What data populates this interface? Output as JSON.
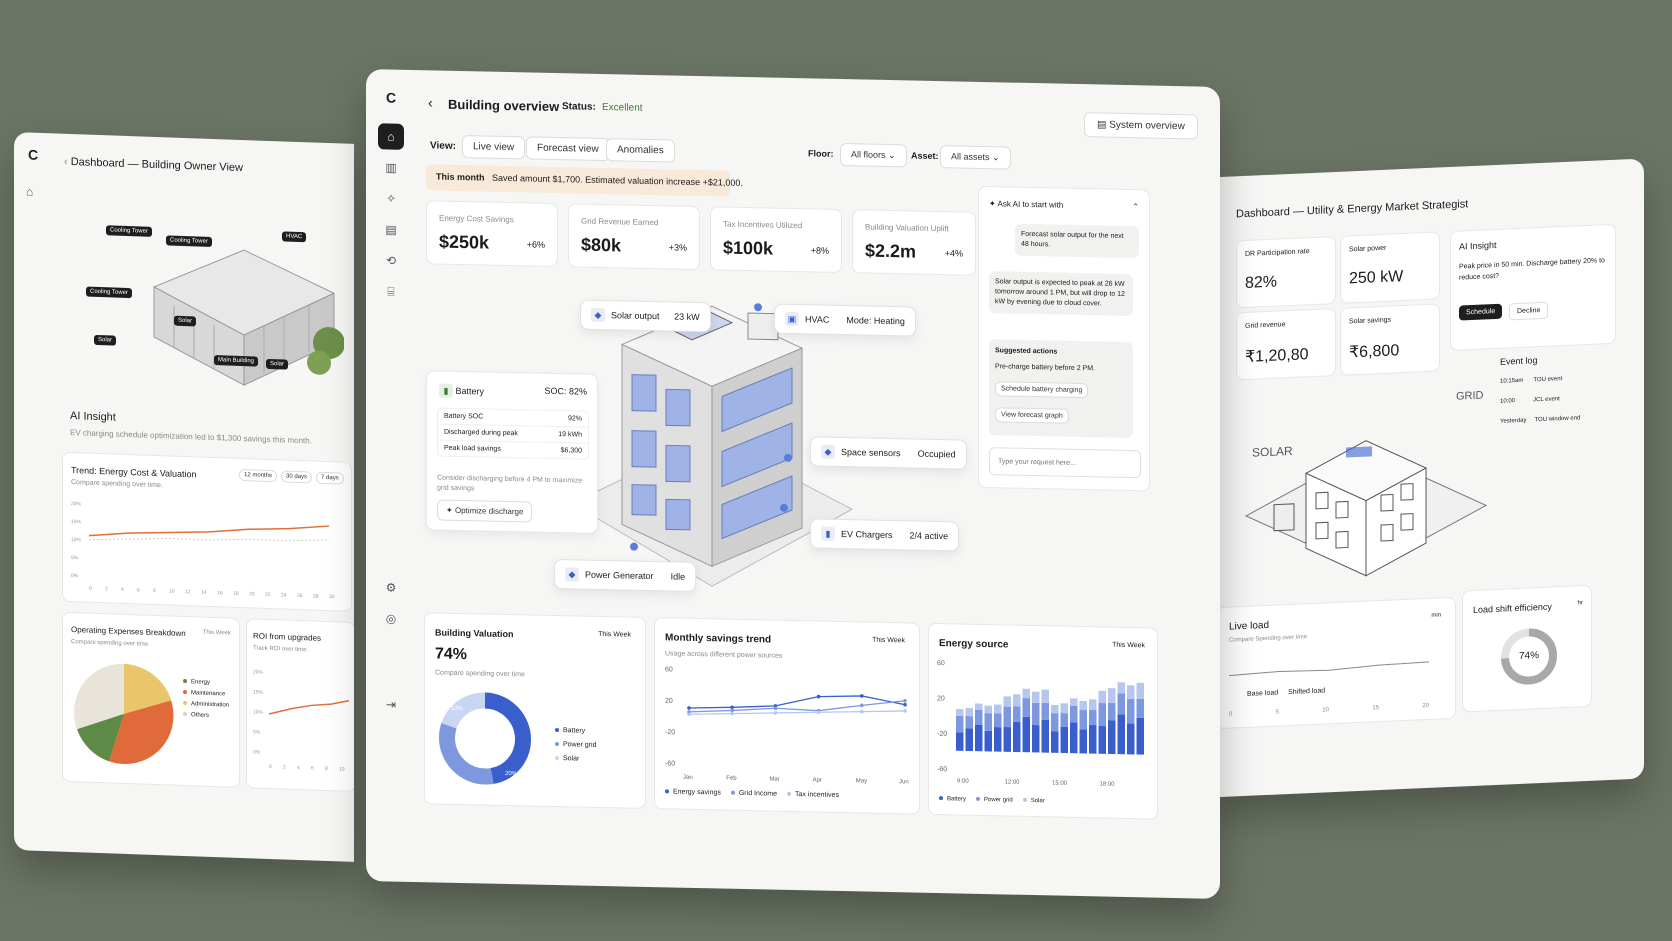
{
  "left": {
    "logo": "C",
    "title": "Dashboard — Building Owner View",
    "tags": [
      "Cooling Tower",
      "Cooling Tower",
      "HVAC",
      "Cooling Tower",
      "Solar",
      "Solar",
      "Main Building",
      "Solar"
    ],
    "ai_insight": {
      "title": "AI Insight",
      "text": "EV charging schedule optimization led to $1,300 savings this month."
    },
    "trend": {
      "title": "Trend: Energy Cost & Valuation",
      "subtitle": "Compare spending over time.",
      "ranges": [
        "12 months",
        "30 days",
        "7 days"
      ],
      "yticks": [
        "20%",
        "15%",
        "10%",
        "5%",
        "0%"
      ],
      "xticks": [
        "0",
        "2",
        "4",
        "6",
        "8",
        "10",
        "12",
        "14",
        "16",
        "18",
        "20",
        "22",
        "24",
        "26",
        "28",
        "30"
      ]
    },
    "opex": {
      "title": "Operating Expenses Breakdown",
      "subtitle": "Compare spending over time.",
      "period": "This Week",
      "legend": [
        "Energy",
        "Maintenance",
        "Administration",
        "Others"
      ]
    },
    "roi": {
      "title": "ROI from upgrades",
      "subtitle": "Track ROI over time.",
      "yticks": [
        "20%",
        "15%",
        "10%",
        "5%",
        "0%"
      ],
      "xticks": [
        "0",
        "2",
        "4",
        "6",
        "8",
        "10"
      ]
    }
  },
  "center": {
    "logo": "C",
    "header": {
      "title": "Building overview",
      "status_label": "Status:",
      "status_value": "Excellent",
      "system_button": "System overview"
    },
    "view_label": "View:",
    "views": [
      "Live view",
      "Forecast view",
      "Anomalies"
    ],
    "floor_label": "Floor:",
    "floor_value": "All floors",
    "asset_label": "Asset:",
    "asset_value": "All assets",
    "banner": {
      "label": "This month",
      "text": "Saved amount $1,700. Estimated valuation increase +$21,000."
    },
    "kpis": [
      {
        "label": "Energy Cost Savings",
        "value": "$250k",
        "delta": "+6%"
      },
      {
        "label": "Grid Revenue Earned",
        "value": "$80k",
        "delta": "+3%"
      },
      {
        "label": "Tax Incentives Utilized",
        "value": "$100k",
        "delta": "+8%"
      },
      {
        "label": "Building Valuation Uplift",
        "value": "$2.2m",
        "delta": "+4%"
      }
    ],
    "floats": {
      "solar": {
        "label": "Solar output",
        "value": "23 kW"
      },
      "hvac": {
        "label": "HVAC",
        "value": "Mode: Heating"
      },
      "sensors": {
        "label": "Space sensors",
        "value": "Occupied"
      },
      "ev": {
        "label": "EV Chargers",
        "value": "2/4 active"
      },
      "generator": {
        "label": "Power Generator",
        "value": "Idle"
      }
    },
    "battery": {
      "title": "Battery",
      "soc": "SOC: 82%",
      "rows": [
        {
          "k": "Battery SOC",
          "v": "92%"
        },
        {
          "k": "Discharged during peak",
          "v": "19 kWh"
        },
        {
          "k": "Peak load savings",
          "v": "$6,300"
        }
      ],
      "note": "Consider discharging before 4 PM to maximize grid savings",
      "button": "Optimize discharge"
    },
    "ai": {
      "title": "Ask AI to start with",
      "prompt": "Forecast solar output for the next 48 hours.",
      "answer": "Solar output is expected to peak at 26 kW tomorrow around 1 PM, but will drop to 12 kW by evening due to cloud cover.",
      "suggested_title": "Suggested actions",
      "suggested_text": "Pre-charge battery before 2 PM.",
      "actions": [
        "Schedule battery charging",
        "View forecast graph"
      ],
      "input_placeholder": "Type your request here..."
    },
    "valuation": {
      "title": "Building Valuation",
      "period": "This Week",
      "value": "74%",
      "subtitle": "Compare spending over time",
      "legend": [
        "Battery",
        "Power grid",
        "Solar"
      ],
      "seg1": "33%",
      "seg2": "20%"
    },
    "savings": {
      "title": "Monthly savings trend",
      "period": "This Week",
      "subtitle": "Usage across different power sources",
      "yticks": [
        "60",
        "20",
        "-20",
        "-60"
      ],
      "xticks": [
        "Jan",
        "Feb",
        "Mar",
        "Apr",
        "May",
        "Jun"
      ],
      "legend": [
        "Energy savings",
        "Grid Income",
        "Tax incentives"
      ]
    },
    "energy": {
      "title": "Energy source",
      "period": "This Week",
      "yticks": [
        "60",
        "20",
        "-20",
        "-60"
      ],
      "xticks": [
        "9:00",
        "12:00",
        "15:00",
        "18:00"
      ],
      "legend": [
        "Battery",
        "Power grid",
        "Solar"
      ]
    }
  },
  "right": {
    "title": "Dashboard — Utility & Energy Market Strategist",
    "kpis": [
      {
        "label": "DR Participation rate",
        "value": "82%"
      },
      {
        "label": "Solar power",
        "value": "250 kW"
      },
      {
        "label": "Grid revenue",
        "value": "₹1,20,80"
      },
      {
        "label": "Solar savings",
        "value": "₹6,800"
      }
    ],
    "ai": {
      "title": "AI Insight",
      "text": "Peak price in 50 min. Discharge battery 20% to reduce cost?",
      "primary": "Schedule",
      "secondary": "Decline"
    },
    "grid_label": "GRID",
    "solar_label": "SOLAR",
    "events": {
      "title": "Event log",
      "items": [
        {
          "t": "10:15am",
          "e": "TOU event"
        },
        {
          "t": "10:00",
          "e": "JCL event"
        },
        {
          "t": "Yesterday",
          "e": "TOU window end"
        }
      ]
    },
    "live": {
      "title": "Live load",
      "subtitle": "Compare Spending over time",
      "period": "min",
      "legend": [
        "Base load",
        "Shifted load"
      ],
      "xticks": [
        "0",
        "5",
        "10",
        "15",
        "20"
      ]
    },
    "shift": {
      "title": "Load shift efficiency",
      "period": "hr",
      "value": "74%"
    }
  },
  "chart_data": [
    {
      "type": "bar",
      "title": "Energy source",
      "categories": [
        "9:00",
        "12:00",
        "15:00",
        "18:00"
      ],
      "series": [
        {
          "name": "Battery",
          "values": [
            30,
            40,
            35,
            45
          ]
        },
        {
          "name": "Power grid",
          "values": [
            20,
            25,
            22,
            28
          ]
        },
        {
          "name": "Solar",
          "values": [
            10,
            15,
            12,
            18
          ]
        }
      ],
      "ylim": [
        -60,
        60
      ]
    },
    {
      "type": "line",
      "title": "Monthly savings trend",
      "x": [
        "Jan",
        "Feb",
        "Mar",
        "Apr",
        "May",
        "Jun"
      ],
      "series": [
        {
          "name": "Energy savings",
          "values": [
            10,
            12,
            15,
            28,
            30,
            20
          ]
        },
        {
          "name": "Grid Income",
          "values": [
            5,
            8,
            12,
            10,
            18,
            25
          ]
        },
        {
          "name": "Tax incentives",
          "values": [
            2,
            4,
            6,
            8,
            10,
            12
          ]
        }
      ],
      "ylim": [
        -60,
        60
      ]
    },
    {
      "type": "pie",
      "title": "Building Valuation",
      "categories": [
        "Battery",
        "Power grid",
        "Solar"
      ],
      "values": [
        47,
        33,
        20
      ]
    }
  ],
  "colors": {
    "accent": "#3a5fcd",
    "banner": "#f7ead8",
    "bg": "#6b7565"
  }
}
